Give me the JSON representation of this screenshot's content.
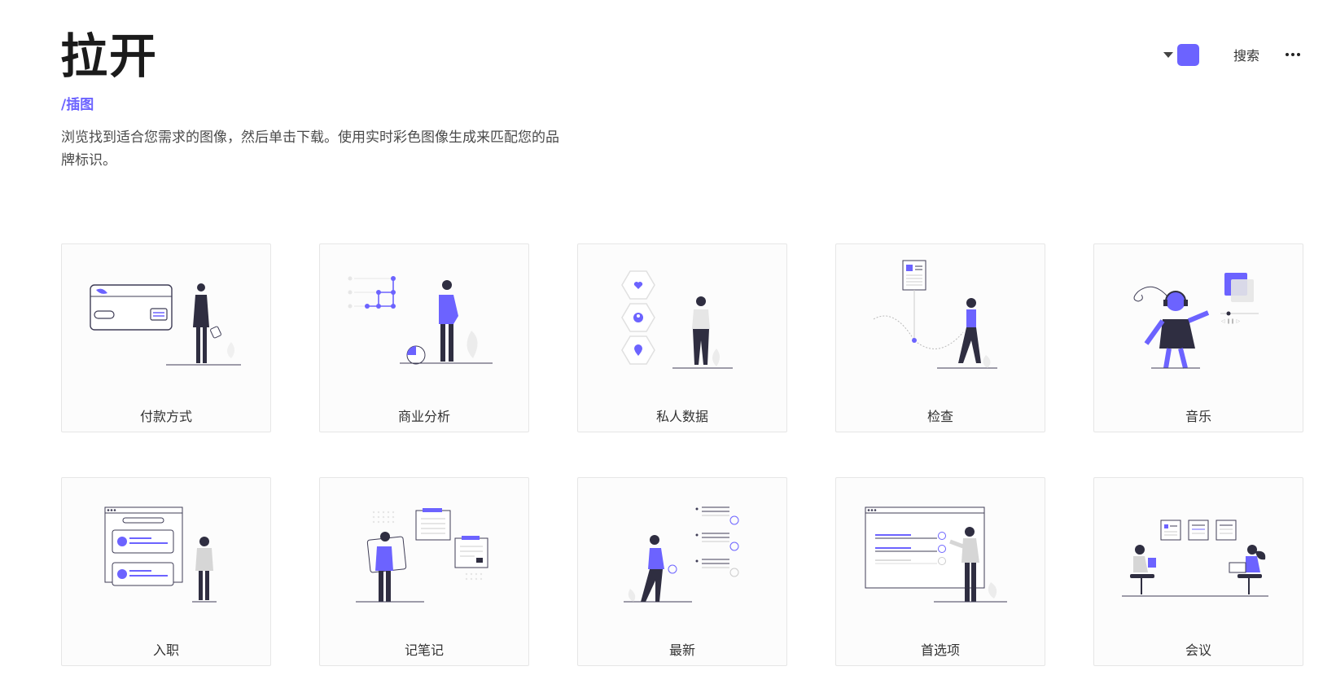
{
  "header": {
    "title": "拉开",
    "breadcrumb": "/插图",
    "description": "浏览找到适合您需求的图像，然后单击下载。使用实时彩色图像生成来匹配您的品牌标识。"
  },
  "toolbar": {
    "accent_color": "#6c63ff",
    "color_picker_icon": "caret-down-icon",
    "search_label": "搜索",
    "more_icon": "more-horizontal-icon"
  },
  "categories": [
    {
      "label": "付款方式"
    },
    {
      "label": "商业分析"
    },
    {
      "label": "私人数据"
    },
    {
      "label": "检查"
    },
    {
      "label": "音乐"
    },
    {
      "label": "入职"
    },
    {
      "label": "记笔记"
    },
    {
      "label": "最新"
    },
    {
      "label": "首选项"
    },
    {
      "label": "会议"
    }
  ]
}
